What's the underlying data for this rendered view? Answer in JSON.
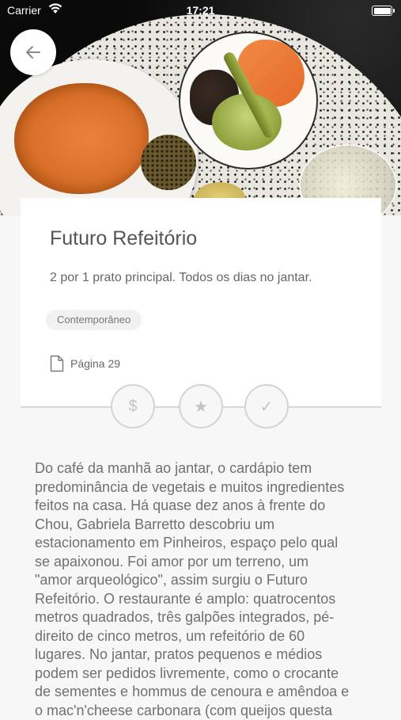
{
  "status_bar": {
    "carrier": "Carrier",
    "time": "17:21"
  },
  "hero": {
    "image_alt": "food-photo"
  },
  "back_button": {
    "icon": "arrow-left-icon"
  },
  "card": {
    "title": "Futuro Refeitório",
    "promo": "2 por 1 prato principal. Todos os dias no jantar.",
    "tag": "Contemporâneo",
    "page_label": "Página 29"
  },
  "actions": [
    {
      "icon": "dollar-icon",
      "glyph": "$"
    },
    {
      "icon": "star-icon",
      "glyph": "★"
    },
    {
      "icon": "check-icon",
      "glyph": "✓"
    }
  ],
  "description": "Do café da manhã ao jantar, o cardápio tem\npredominância de vegetais e muitos ingredientes\nfeitos na casa. Há quase dez anos à frente do\nChou, Gabriela Barretto descobriu um\nestacionamento em Pinheiros, espaço pelo qual\nse apaixonou. Foi amor por um terreno, um\n\"amor arqueológico\", assim surgiu o Futuro\nRefeitório. O restaurante é amplo: quatrocentos\nmetros quadrados, três galpões integrados, pé-\ndireito de cinco metros, um refeitório de 60\nlugares. No jantar, pratos pequenos e médios\npodem ser pedidos livremente, como o crocante\nde sementes e hommus de cenoura e amêndoa e\no mac'n'cheese carbonara (com queijos questa",
  "colors": {
    "accent_text": "#555555",
    "card_bg": "#ffffff",
    "page_bg": "#f7f7f7",
    "action_border": "#d4d4d4"
  }
}
